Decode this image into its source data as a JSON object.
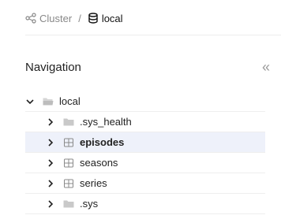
{
  "breadcrumb": {
    "cluster_label": "Cluster",
    "separator": "/",
    "current_label": "local"
  },
  "navigation": {
    "title": "Navigation",
    "collapse_icon": "double-chevron-left-icon"
  },
  "tree": {
    "root": {
      "label": "local",
      "icon": "folder-open-icon",
      "expanded": true
    },
    "children": [
      {
        "label": ".sys_health",
        "icon": "folder-icon",
        "selected": false
      },
      {
        "label": "episodes",
        "icon": "table-icon",
        "selected": true
      },
      {
        "label": "seasons",
        "icon": "table-icon",
        "selected": false
      },
      {
        "label": "series",
        "icon": "table-icon",
        "selected": false
      },
      {
        "label": ".sys",
        "icon": "folder-icon",
        "selected": false
      }
    ]
  },
  "colors": {
    "selected_bg": "#eef1fa",
    "muted_text": "#888888",
    "folder_gray": "#c4c4c4"
  }
}
